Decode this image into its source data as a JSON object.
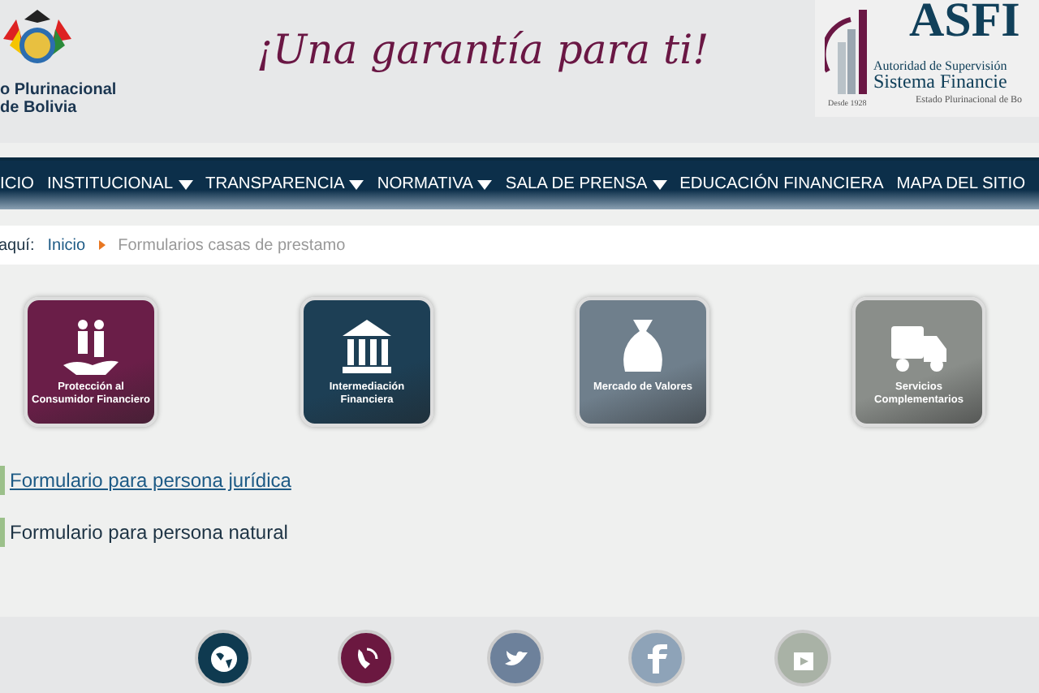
{
  "header": {
    "coat_text": [
      "o Plurinacional",
      "de Bolivia"
    ],
    "slogan": "¡Una garantía para ti!",
    "logo": {
      "acronym": "ASFI",
      "line_1": "Autoridad de Supervisión",
      "line_2": "Sistema Financie",
      "line_3": "Estado Plurinacional de Bo",
      "since": "Desde 1928"
    }
  },
  "nav": [
    {
      "label": "ICIO",
      "dropdown": false
    },
    {
      "label": "INSTITUCIONAL",
      "dropdown": true
    },
    {
      "label": "TRANSPARENCIA",
      "dropdown": true
    },
    {
      "label": "NORMATIVA",
      "dropdown": true
    },
    {
      "label": "SALA DE PRENSA",
      "dropdown": true
    },
    {
      "label": "EDUCACIÓN FINANCIERA",
      "dropdown": false
    },
    {
      "label": "MAPA DEL SITIO",
      "dropdown": false
    }
  ],
  "breadcrumb": {
    "prefix": "aquí:",
    "items": [
      "Inicio",
      "Formularios casas de prestamo"
    ]
  },
  "tiles": [
    {
      "label": "Protección al Consumidor Financiero",
      "kind": "people",
      "color": "#6a1e48"
    },
    {
      "label": "Intermediación Financiera",
      "kind": "bank",
      "color": "#1d3f55"
    },
    {
      "label": "Mercado de Valores",
      "kind": "moneybag",
      "color": "#6f7f8c"
    },
    {
      "label": "Servicios Complementarios",
      "kind": "truck",
      "color": "#8a8e8a"
    }
  ],
  "links": [
    {
      "label": "Formulario para persona jurídica",
      "underlined": true
    },
    {
      "label": "Formulario para persona natural",
      "underlined": false
    }
  ],
  "footer_icons": [
    {
      "kind": "globe",
      "color": "#0f3a50"
    },
    {
      "kind": "phone",
      "color": "#6b1840"
    },
    {
      "kind": "bird",
      "color": "#6d819b"
    },
    {
      "kind": "f",
      "color": "#8ea3b8"
    },
    {
      "kind": "play",
      "color": "#a9b2a6"
    }
  ]
}
